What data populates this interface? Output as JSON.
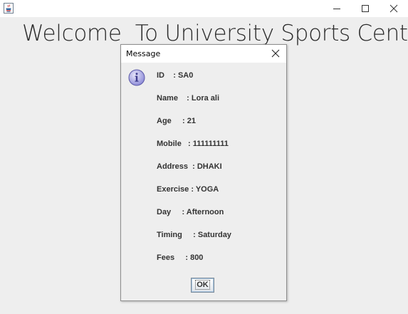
{
  "window": {
    "icon": "java-coffee-cup-icon",
    "controls": [
      "minimize-icon",
      "maximize-icon",
      "close-icon"
    ]
  },
  "main": {
    "welcome_text": "Welcome  To University Sports Center"
  },
  "dialog": {
    "title": "Message",
    "icon": "info-icon",
    "lines": [
      "ID    : SA0",
      "Name    : Lora ali",
      "Age     : 21",
      "Mobile   : 111111111",
      "Address  : DHAKI",
      "Exercise : YOGA",
      "Day     : Afternoon",
      "Timing     : Saturday",
      "Fees     : 800"
    ],
    "ok_label": "OK"
  },
  "colors": {
    "background": "#eeeeee",
    "titlebar": "#ffffff",
    "info_icon": "#7a78c8",
    "text": "#333333"
  }
}
